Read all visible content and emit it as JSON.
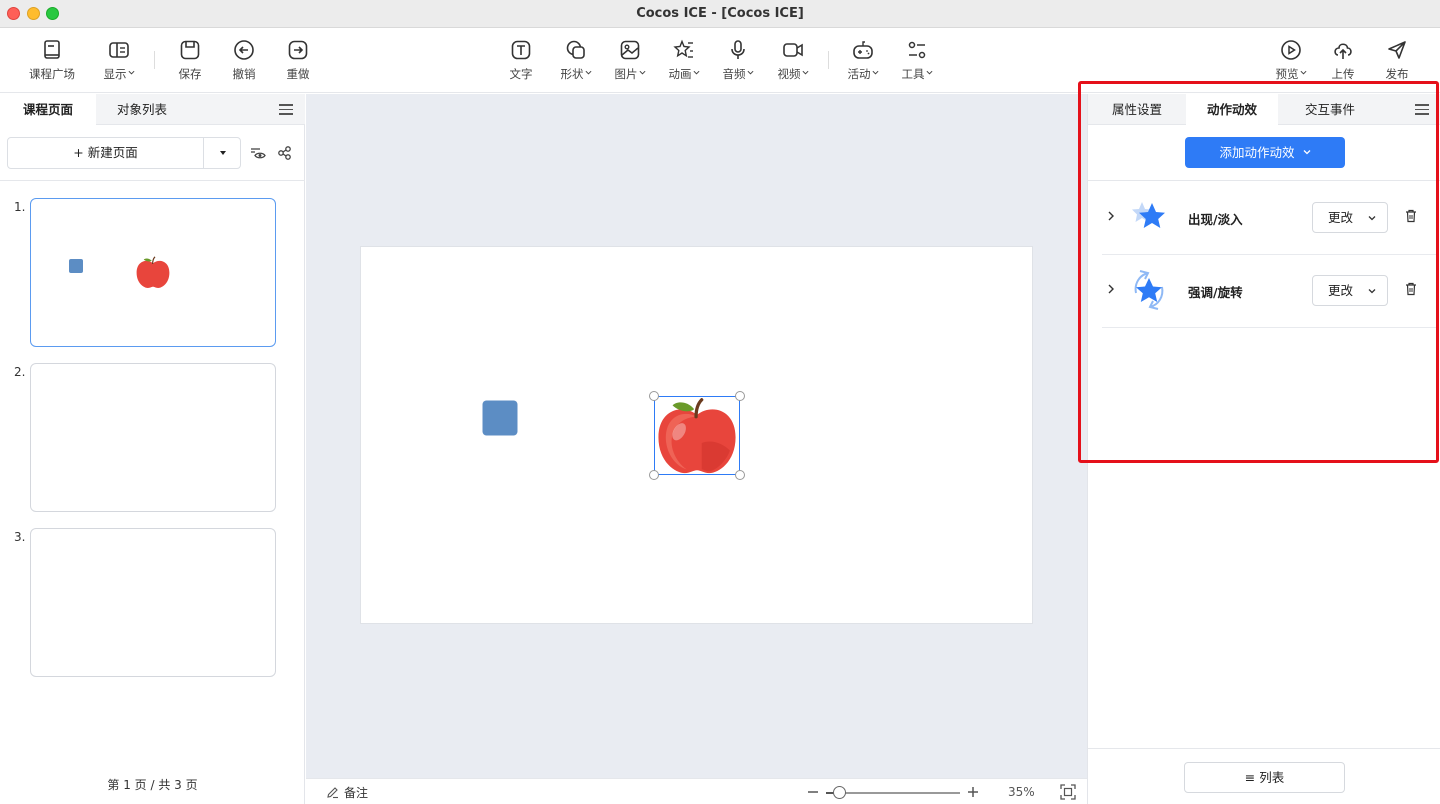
{
  "window": {
    "title": "Cocos ICE - [Cocos ICE]"
  },
  "toolbar": {
    "left": [
      {
        "label": "课程广场",
        "icon": "book-icon"
      },
      {
        "label": "显示",
        "icon": "layout-icon",
        "dropdown": true
      },
      {
        "label": "保存",
        "icon": "save-icon"
      },
      {
        "label": "撤销",
        "icon": "undo-icon"
      },
      {
        "label": "重做",
        "icon": "redo-icon"
      }
    ],
    "center": [
      {
        "label": "文字",
        "icon": "text-icon"
      },
      {
        "label": "形状",
        "icon": "shape-icon",
        "dropdown": true
      },
      {
        "label": "图片",
        "icon": "image-icon",
        "dropdown": true
      },
      {
        "label": "动画",
        "icon": "animation-star-icon",
        "dropdown": true
      },
      {
        "label": "音频",
        "icon": "microphone-icon",
        "dropdown": true
      },
      {
        "label": "视频",
        "icon": "video-icon",
        "dropdown": true
      },
      {
        "label": "活动",
        "icon": "gamepad-icon",
        "dropdown": true
      },
      {
        "label": "工具",
        "icon": "tools-icon",
        "dropdown": true
      }
    ],
    "right": [
      {
        "label": "预览",
        "icon": "play-icon",
        "dropdown": true
      },
      {
        "label": "上传",
        "icon": "upload-icon"
      },
      {
        "label": "发布",
        "icon": "send-icon"
      }
    ]
  },
  "left_panel": {
    "tabs": [
      "课程页面",
      "对象列表"
    ],
    "new_page_label": "+ 新建页面",
    "pages": [
      "1.",
      "2.",
      "3."
    ],
    "page_count": "第 1 页 / 共 3 页"
  },
  "canvas": {
    "note_label": "备注",
    "zoom": "35%",
    "zoom_fraction": 0.35
  },
  "right_panel": {
    "tabs": [
      "属性设置",
      "动作动效",
      "交互事件"
    ],
    "add_button": "添加动作动效",
    "animations": [
      {
        "name": "出现/淡入",
        "change_label": "更改",
        "icon": "star-fade-in-icon"
      },
      {
        "name": "强调/旋转",
        "change_label": "更改",
        "icon": "star-rotate-icon"
      }
    ],
    "list_button": "≡ 列表"
  },
  "colors": {
    "accent": "#2e7bf6",
    "highlight_frame": "#e5101a",
    "square_shape": "#5c8dc4",
    "apple": "#e8453c"
  }
}
